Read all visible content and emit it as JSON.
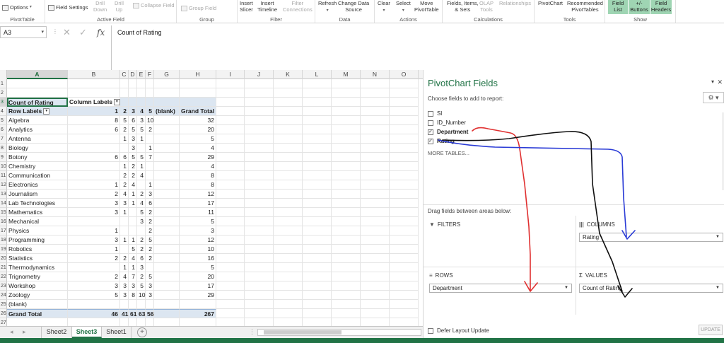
{
  "ribbon": {
    "groups": [
      {
        "name": "PivotTable",
        "buttons": [
          {
            "label": "Options",
            "dim": false
          }
        ]
      },
      {
        "name": "Active Field",
        "buttons": [
          {
            "label": "Field Settings",
            "dim": false
          },
          {
            "label": "Drill\nDown",
            "dim": true
          },
          {
            "label": "Drill\nUp",
            "dim": true
          },
          {
            "label": "Collapse Field",
            "dim": true
          }
        ]
      },
      {
        "name": "Group",
        "buttons": [
          {
            "label": "Group Field",
            "dim": true
          }
        ]
      },
      {
        "name": "Filter",
        "buttons": [
          {
            "label": "Insert\nSlicer",
            "dim": false
          },
          {
            "label": "Insert\nTimeline",
            "dim": false
          },
          {
            "label": "Filter\nConnections",
            "dim": true
          }
        ]
      },
      {
        "name": "Data",
        "buttons": [
          {
            "label": "Refresh",
            "dim": false
          },
          {
            "label": "Change Data\nSource",
            "dim": false
          }
        ]
      },
      {
        "name": "Actions",
        "buttons": [
          {
            "label": "Clear",
            "dim": false
          },
          {
            "label": "Select",
            "dim": false
          },
          {
            "label": "Move\nPivotTable",
            "dim": false
          }
        ]
      },
      {
        "name": "Calculations",
        "buttons": [
          {
            "label": "Fields, Items,\n& Sets",
            "dim": false
          },
          {
            "label": "OLAP\nTools",
            "dim": true
          },
          {
            "label": "Relationships",
            "dim": true
          }
        ]
      },
      {
        "name": "Tools",
        "buttons": [
          {
            "label": "PivotChart",
            "dim": false
          },
          {
            "label": "Recommended\nPivotTables",
            "dim": false
          }
        ]
      },
      {
        "name": "Show",
        "buttons": [
          {
            "label": "Field\nList",
            "dim": false
          },
          {
            "label": "+/-\nButtons",
            "dim": false
          },
          {
            "label": "Field\nHeaders",
            "dim": false
          }
        ]
      }
    ]
  },
  "formula": {
    "namebox": "A3",
    "content": "Count of Rating",
    "fx": "fx"
  },
  "grid": {
    "columns": [
      "A",
      "B",
      "C",
      "D",
      "E",
      "F",
      "G",
      "H",
      "I",
      "J",
      "K",
      "L",
      "M",
      "N",
      "O"
    ],
    "pivot": {
      "title": "Count of Rating",
      "column_labels": "Column Labels",
      "row_labels": "Row Labels",
      "headers": [
        "1",
        "2",
        "3",
        "4",
        "5",
        "(blank)",
        "Grand Total"
      ],
      "rows": [
        {
          "label": "Algebra",
          "v": [
            "8",
            "5",
            "6",
            "3",
            "10",
            "",
            "32"
          ]
        },
        {
          "label": "Analytics",
          "v": [
            "6",
            "2",
            "5",
            "5",
            "2",
            "",
            "20"
          ]
        },
        {
          "label": "Antenna",
          "v": [
            "",
            "1",
            "3",
            "1",
            "",
            "",
            "5"
          ]
        },
        {
          "label": "Biology",
          "v": [
            "",
            "",
            "3",
            "",
            "1",
            "",
            "4"
          ]
        },
        {
          "label": "Botony",
          "v": [
            "6",
            "6",
            "5",
            "5",
            "7",
            "",
            "29"
          ]
        },
        {
          "label": "Chemistry",
          "v": [
            "",
            "1",
            "2",
            "1",
            "",
            "",
            "4"
          ]
        },
        {
          "label": "Communication",
          "v": [
            "",
            "2",
            "2",
            "4",
            "",
            "",
            "8"
          ]
        },
        {
          "label": "Electronics",
          "v": [
            "1",
            "2",
            "4",
            "",
            "1",
            "",
            "8"
          ]
        },
        {
          "label": "Journalism",
          "v": [
            "2",
            "4",
            "1",
            "2",
            "3",
            "",
            "12"
          ]
        },
        {
          "label": "Lab Technologies",
          "v": [
            "3",
            "3",
            "1",
            "4",
            "6",
            "",
            "17"
          ]
        },
        {
          "label": "Mathematics",
          "v": [
            "3",
            "1",
            "",
            "5",
            "2",
            "",
            "11"
          ]
        },
        {
          "label": "Mechanical",
          "v": [
            "",
            "",
            "",
            "3",
            "2",
            "",
            "5"
          ]
        },
        {
          "label": "Physics",
          "v": [
            "1",
            "",
            "",
            "",
            "2",
            "",
            "3"
          ]
        },
        {
          "label": "Programming",
          "v": [
            "3",
            "1",
            "1",
            "2",
            "5",
            "",
            "12"
          ]
        },
        {
          "label": "Robotics",
          "v": [
            "1",
            "",
            "5",
            "2",
            "2",
            "",
            "10"
          ]
        },
        {
          "label": "Statistics",
          "v": [
            "2",
            "2",
            "4",
            "6",
            "2",
            "",
            "16"
          ]
        },
        {
          "label": "Thermodynamics",
          "v": [
            "",
            "1",
            "1",
            "3",
            "",
            "",
            "5"
          ]
        },
        {
          "label": "Trignometry",
          "v": [
            "2",
            "4",
            "7",
            "2",
            "5",
            "",
            "20"
          ]
        },
        {
          "label": "Workshop",
          "v": [
            "3",
            "3",
            "3",
            "5",
            "3",
            "",
            "17"
          ]
        },
        {
          "label": "Zoology",
          "v": [
            "5",
            "3",
            "8",
            "10",
            "3",
            "",
            "29"
          ]
        },
        {
          "label": "(blank)",
          "v": [
            "",
            "",
            "",
            "",
            "",
            "",
            ""
          ]
        }
      ],
      "grand_total": {
        "label": "Grand Total",
        "v": [
          "46",
          "41",
          "61",
          "63",
          "56",
          "",
          "267"
        ]
      }
    }
  },
  "sheets": {
    "tabs": [
      "Sheet2",
      "Sheet3",
      "Sheet1"
    ],
    "active": "Sheet3",
    "add_label": "+"
  },
  "pane": {
    "title": "PivotChart Fields",
    "subtitle": "Choose fields to add to report:",
    "fields": [
      {
        "name": "Sl",
        "checked": false
      },
      {
        "name": "ID_Number",
        "checked": false
      },
      {
        "name": "Department",
        "checked": true
      },
      {
        "name": "Rating",
        "checked": true
      }
    ],
    "more_tables": "MORE TABLES...",
    "drag_label": "Drag fields between areas below:",
    "areas": {
      "filters": {
        "label": "FILTERS",
        "item": ""
      },
      "columns": {
        "label": "COLUMNS",
        "item": "Rating"
      },
      "rows": {
        "label": "ROWS",
        "item": "Department"
      },
      "values": {
        "label": "VALUES",
        "item": "Count of Rating"
      }
    },
    "defer_label": "Defer Layout Update",
    "update_label": "UPDATE"
  },
  "colors": {
    "excel_green": "#217346",
    "pivot_header": "#dce6f1",
    "annotation_red": "#e03030",
    "annotation_blue": "#2a3bd6",
    "annotation_black": "#111111"
  }
}
